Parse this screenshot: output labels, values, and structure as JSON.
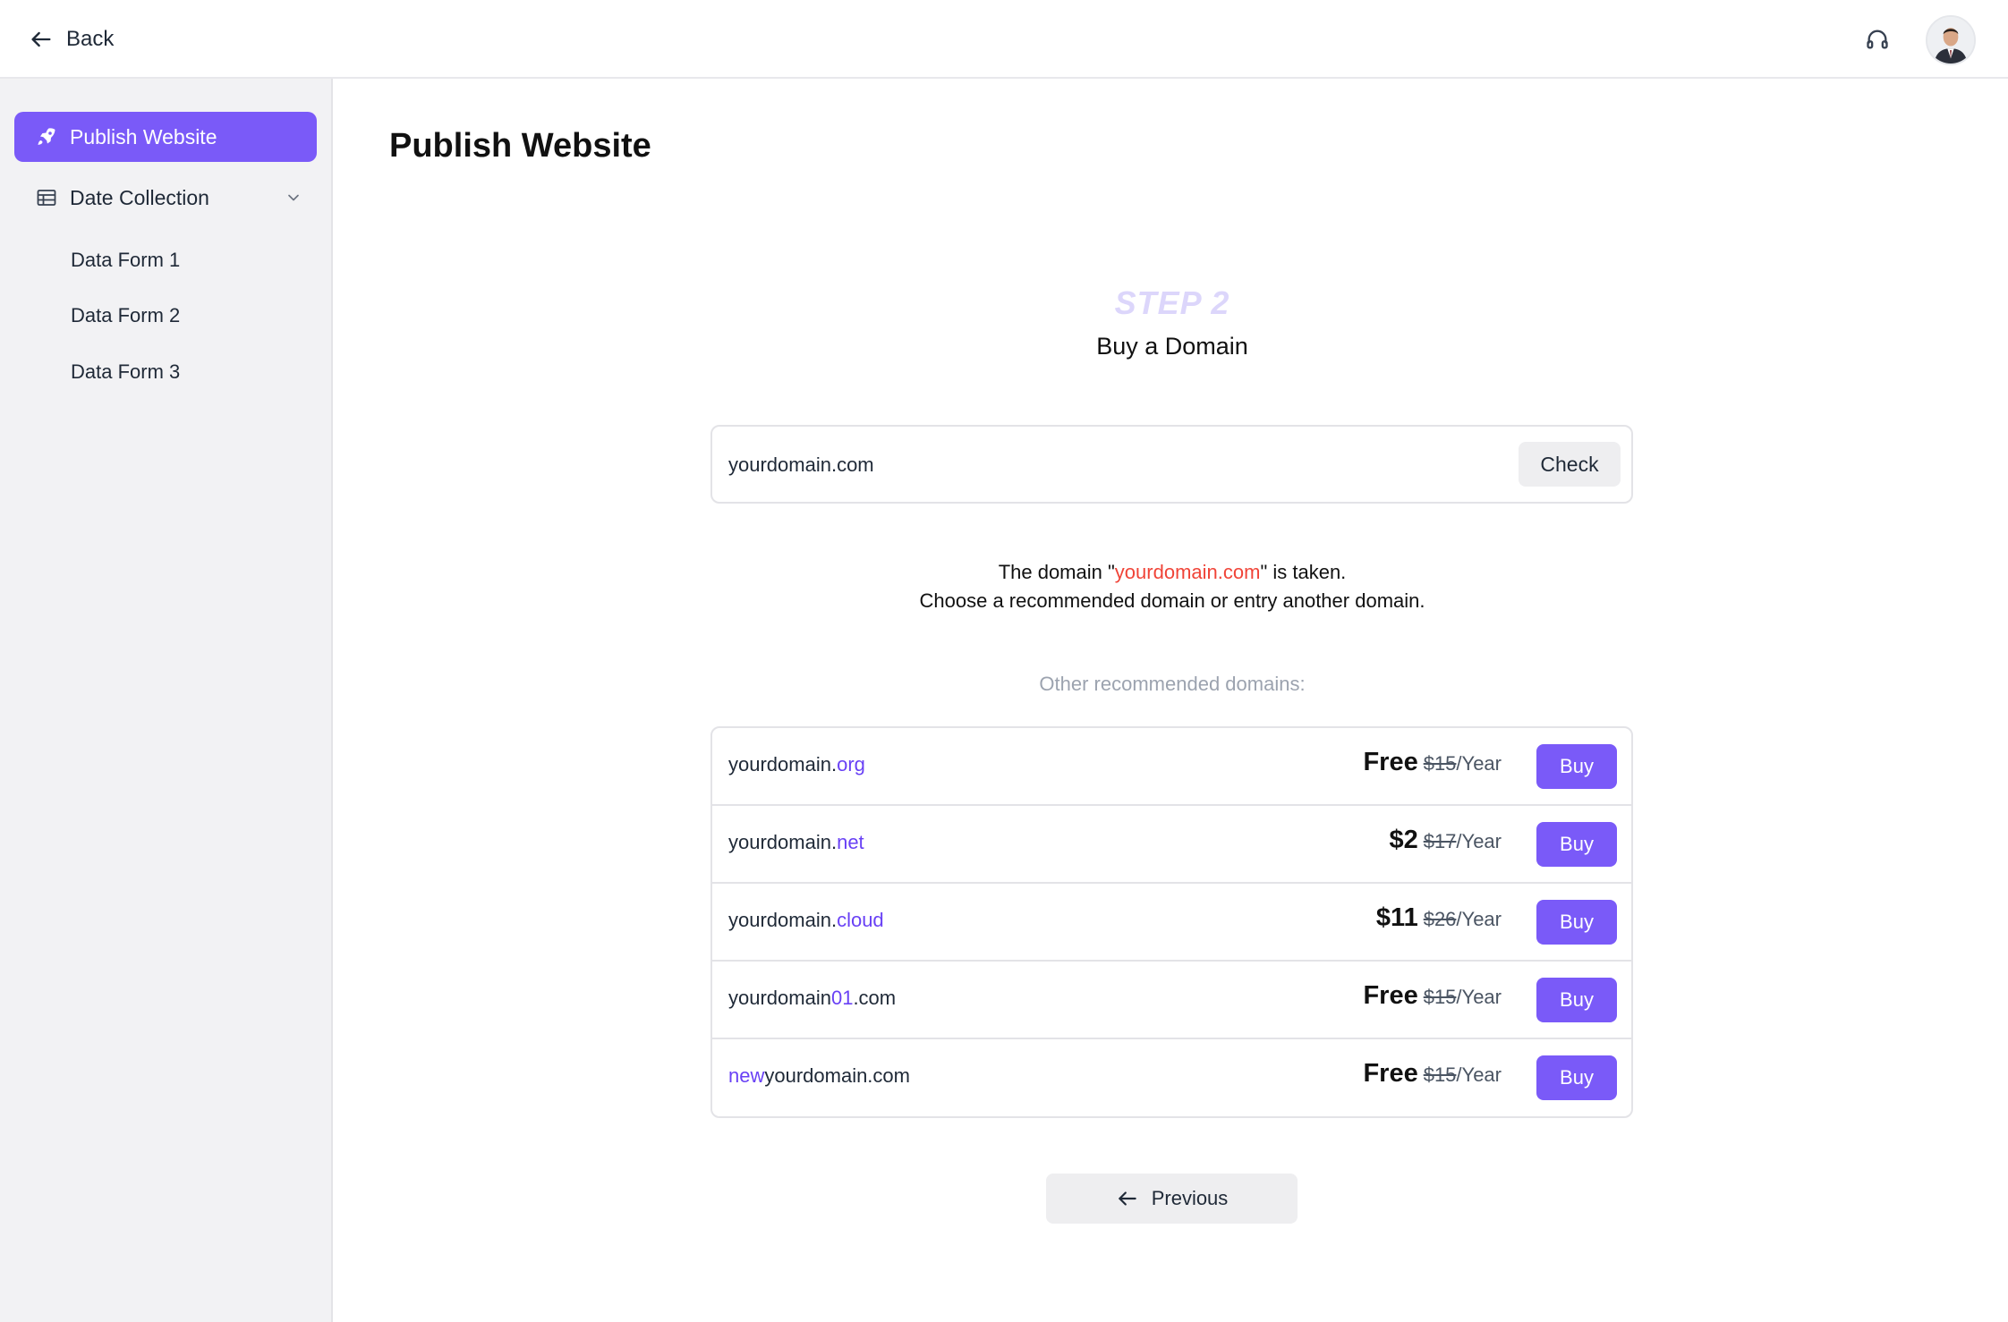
{
  "topbar": {
    "back_label": "Back",
    "support_icon": "headset-icon",
    "avatar_icon": "user-avatar"
  },
  "sidebar": {
    "active_item": {
      "label": "Publish Website",
      "icon": "rocket-icon"
    },
    "group": {
      "label": "Date Collection",
      "icon": "table-icon",
      "expanded": true
    },
    "sub_items": [
      {
        "label": "Data Form 1"
      },
      {
        "label": "Data Form 2"
      },
      {
        "label": "Data Form 3"
      }
    ]
  },
  "main": {
    "page_title": "Publish Website",
    "step_label": "STEP 2",
    "step_title": "Buy a Domain",
    "domain_input_value": "yourdomain.com",
    "check_label": "Check",
    "message": {
      "line1_prefix": "The domain \"",
      "line1_domain": "yourdomain.com",
      "line1_suffix": "\" is taken.",
      "line2": "Choose a recommended domain or entry another domain."
    },
    "recommended_label": "Other recommended domains:",
    "domains": [
      {
        "pre": "yourdomain.",
        "highlight": "org",
        "post": "",
        "price": "Free",
        "old_price": "$15",
        "period": "/Year",
        "buy_label": "Buy"
      },
      {
        "pre": "yourdomain.",
        "highlight": "net",
        "post": "",
        "price": "$2",
        "old_price": "$17",
        "period": "/Year",
        "buy_label": "Buy"
      },
      {
        "pre": "yourdomain.",
        "highlight": "cloud",
        "post": "",
        "price": "$11",
        "old_price": "$26",
        "period": "/Year",
        "buy_label": "Buy"
      },
      {
        "pre": "yourdomain",
        "highlight": "01",
        "post": ".com",
        "price": "Free",
        "old_price": "$15",
        "period": "/Year",
        "buy_label": "Buy"
      },
      {
        "pre": "",
        "highlight": "new",
        "post": "yourdomain.com",
        "price": "Free",
        "old_price": "$15",
        "period": "/Year",
        "buy_label": "Buy"
      }
    ],
    "previous_label": "Previous"
  },
  "colors": {
    "accent": "#7a5af8",
    "highlight_text": "#6941f5",
    "taken_text": "#f04438",
    "step_label": "#dcd6fb",
    "sidebar_bg": "#f2f2f4"
  }
}
